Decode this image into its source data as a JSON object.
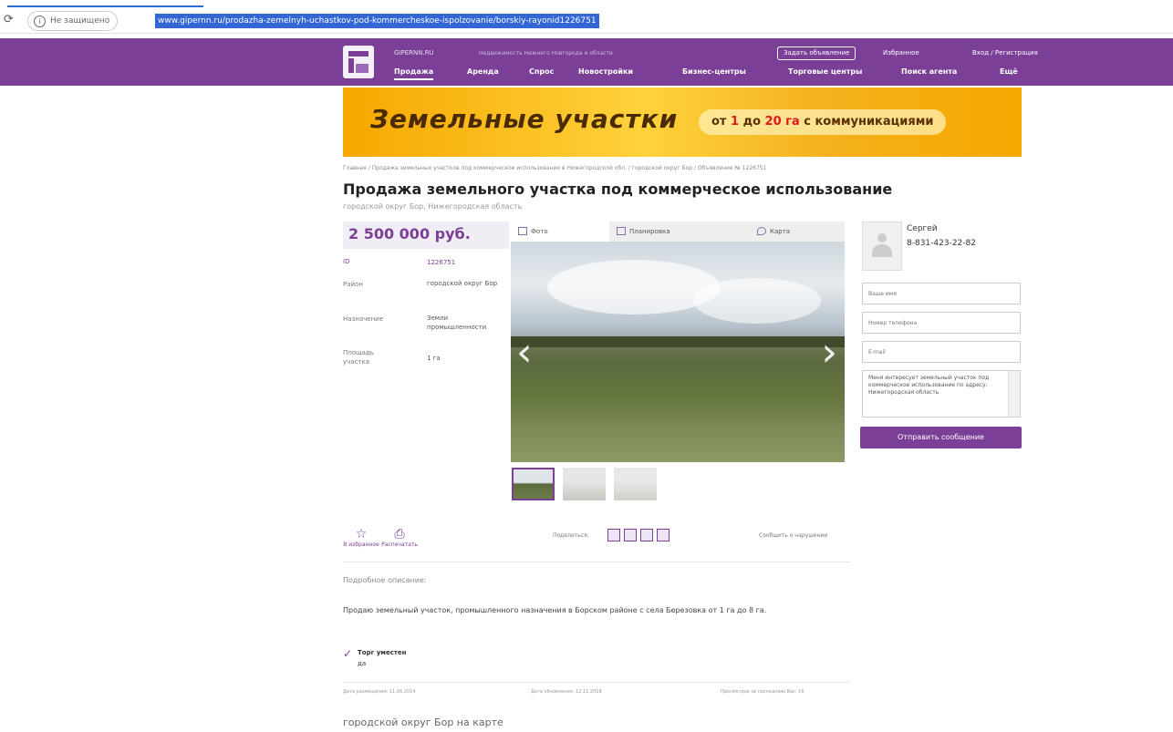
{
  "browser": {
    "security_label": "Не защищено",
    "url": "www.gipernn.ru/prodazha-zemelnyh-uchastkov-pod-kommercheskoe-ispolzovanie/borskiy-rayonid1226751"
  },
  "header": {
    "site_name": "GIPERNN.RU",
    "slogan": "Недвижимость Нижнего Новгорода и области",
    "favorite_search": "Задать объявление",
    "favorites": "Избранное",
    "login": "Вход / Регистрация",
    "nav": [
      "Продажа",
      "Аренда",
      "Спрос",
      "Новостройки",
      "Бизнес-центры",
      "Торговые центры",
      "Поиск агента",
      "Ещё"
    ]
  },
  "banner": {
    "title": "Земельные участки",
    "sub_prefix": "от ",
    "sub_n1": "1",
    "sub_mid": " до ",
    "sub_n2": "20 га",
    "sub_suffix": " с коммуникациями"
  },
  "breadcrumb": "Главная / Продажа земельных участков под коммерческое использование в Нижегородской обл. / городской округ Бор / Объявление № 1226751",
  "listing": {
    "title": "Продажа земельного участка под коммерческое использование",
    "location": "городской округ Бор, Нижегородская область",
    "price": "2 500 000 руб.",
    "props": [
      {
        "label": "ID",
        "value": "1226751"
      },
      {
        "label": "Район",
        "value": "городской округ Бор"
      },
      {
        "label": "Назначение",
        "value": "Земли промышленности"
      },
      {
        "label": "Площадь участка",
        "value": "1 га"
      }
    ]
  },
  "gallery": {
    "tabs": [
      "Фото",
      "Планировка",
      "Карта"
    ]
  },
  "contact": {
    "name": "Сергей",
    "phone": "8-831-423-22-82",
    "name_placeholder": "Ваше имя",
    "phone_placeholder": "Номер телефона",
    "email_placeholder": "E-mail",
    "message": "Меня интересует земельный участок под коммерческое использование по адресу: Нижегородская область",
    "send_label": "Отправить сообщение"
  },
  "actions": {
    "favorite": "В избранное",
    "print": "Распечатать",
    "share_label": "Поделиться:",
    "complain": "Сообщить о нарушении"
  },
  "description": {
    "heading": "Подробное описание:",
    "text": "Продаю земельный участок, промышленного назначения в Борском районе с села Березовка от 1 га до 8 га.",
    "bargain_label": "Торг уместен",
    "bargain_value": "да"
  },
  "meta": {
    "posted": "Дата размещения: 11.06.2014",
    "updated": "Дата обновления: 12.11.2018",
    "views": "Просмотров за последнюю Вас: 16"
  },
  "map_title": "городской округ Бор на карте",
  "colors": {
    "brand": "#7b3f98",
    "banner": "#f6a800"
  }
}
